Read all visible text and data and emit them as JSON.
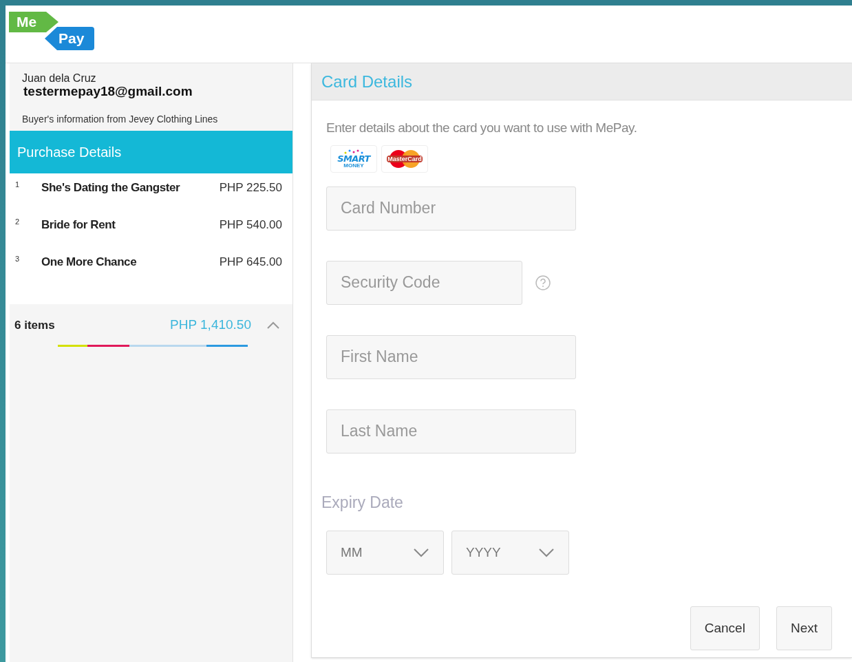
{
  "logo": {
    "top": "Me",
    "bottom": "Pay"
  },
  "buyer": {
    "name": "Juan dela Cruz",
    "email": "testermepay18@gmail.com",
    "note": "Buyer's information from Jevey Clothing Lines"
  },
  "purchase": {
    "title": "Purchase Details",
    "items": [
      {
        "index": "1",
        "name": "She's Dating the Gangster",
        "price": "PHP 225.50"
      },
      {
        "index": "2",
        "name": "Bride for Rent",
        "price": "PHP 540.00"
      },
      {
        "index": "3",
        "name": "One More Chance",
        "price": "PHP 645.00"
      }
    ],
    "count": "6 items",
    "total": "PHP 1,410.50",
    "expanded": true
  },
  "card": {
    "title": "Card Details",
    "intro": "Enter details about the card you want to use with MePay.",
    "logos": [
      {
        "kind": "smart",
        "text": "SMART",
        "subtext": "MONEY"
      },
      {
        "kind": "mastercard",
        "text": "MasterCard"
      }
    ],
    "fields": [
      {
        "placeholder": "Card Number",
        "kind": "wide"
      },
      {
        "placeholder": "Security Code",
        "kind": "help"
      },
      {
        "placeholder": "First Name",
        "kind": "wide"
      },
      {
        "placeholder": "Last Name",
        "kind": "wide"
      }
    ],
    "expiry_label": "Expiry Date",
    "selects": [
      {
        "value": "MM"
      },
      {
        "value": "YYYY"
      }
    ],
    "buttons": [
      "Cancel",
      "Next"
    ]
  }
}
